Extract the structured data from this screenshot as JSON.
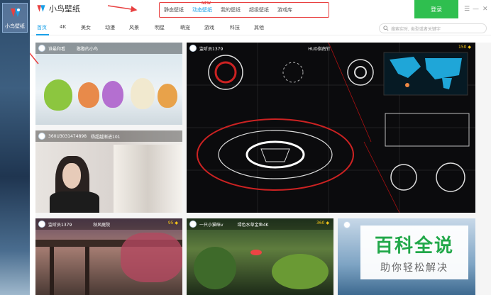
{
  "desktop": {
    "icon_label": "小鸟壁纸"
  },
  "app": {
    "name": "小鸟壁纸"
  },
  "top_tabs": [
    {
      "label": "静态壁纸",
      "active": false
    },
    {
      "label": "动态壁纸",
      "active": true,
      "badge": "NEW"
    },
    {
      "label": "我的壁纸",
      "active": false
    },
    {
      "label": "超级壁纸",
      "active": false
    },
    {
      "label": "游戏库",
      "active": false
    }
  ],
  "login_label": "登录",
  "window_controls": [
    "☰",
    "—",
    "✕"
  ],
  "categories": [
    "首页",
    "4K",
    "美女",
    "动漫",
    "风景",
    "明星",
    "萌宠",
    "游戏",
    "科技",
    "其他"
  ],
  "search": {
    "placeholder": "搜索实时, 类型或者关键字"
  },
  "cards": [
    {
      "author": "谁最和看",
      "title": "憨憨的小鸟",
      "coins": ""
    },
    {
      "author": "360U3031474898",
      "title": "杨超越渐进101",
      "coins": ""
    },
    {
      "author": "监听员1379",
      "title": "HUD指南针",
      "coins": "150"
    },
    {
      "author": "监听员1379",
      "title": "秋风庭院",
      "coins": "95"
    },
    {
      "author": "一只小猫咪v",
      "title": "绿色水草金鱼4K",
      "coins": "360"
    }
  ],
  "watermark": {
    "title": "百科全说",
    "subtitle": "助你轻松解决"
  },
  "colors": {
    "accent": "#1aa0e8",
    "login": "#2fbf4f",
    "annotation": "#e84040",
    "coin": "#f5c518"
  }
}
